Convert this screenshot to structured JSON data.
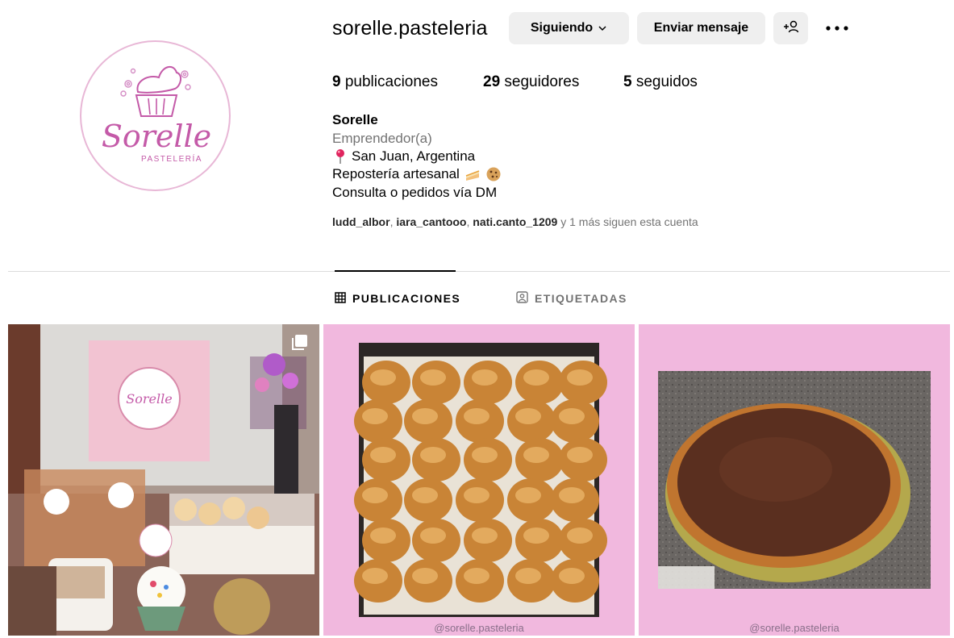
{
  "profile": {
    "username": "sorelle.pasteleria",
    "avatar_alt": "Sorelle Pastelería logo",
    "logo_title": "Sorelle",
    "logo_subtitle": "PASTELERÍA"
  },
  "actions": {
    "following_label": "Siguiendo",
    "message_label": "Enviar mensaje",
    "add_user_icon": "add-user-icon",
    "more_icon": "more-options-icon"
  },
  "stats": {
    "posts_count": "9",
    "posts_label": "publicaciones",
    "followers_count": "29",
    "followers_label": "seguidores",
    "following_count": "5",
    "following_label": "seguidos"
  },
  "bio": {
    "name": "Sorelle",
    "category": "Emprendedor(a)",
    "location": "San Juan, Argentina",
    "description": "Repostería artesanal",
    "contact": "Consulta o pedidos vía DM"
  },
  "followed_by": {
    "users": [
      "ludd_albor",
      "iara_cantooo",
      "nati.canto_1209"
    ],
    "suffix": "y 1 más siguen esta cuenta"
  },
  "tabs": [
    {
      "label": "PUBLICACIONES",
      "icon": "grid-icon",
      "active": true
    },
    {
      "label": "ETIQUETADAS",
      "icon": "tagged-icon",
      "active": false
    }
  ],
  "posts": [
    {
      "alt": "Mesa de productos Sorelle",
      "multi": true,
      "watermark": ""
    },
    {
      "alt": "Bandeja de pancitos",
      "multi": false,
      "watermark": "@sorelle.pasteleria"
    },
    {
      "alt": "Tarta de chocolate y dulce de leche",
      "multi": false,
      "watermark": "@sorelle.pasteleria"
    }
  ],
  "colors": {
    "accent_pink": "#f1b8de",
    "logo_pink": "#c45aa8",
    "button_bg": "#efefef",
    "muted_text": "#737373"
  }
}
